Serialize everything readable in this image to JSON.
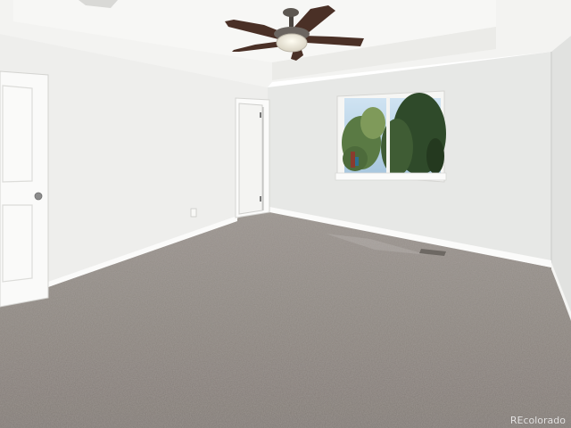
{
  "photo": {
    "subject": "empty-bedroom",
    "watermark": "REcolorado",
    "colors": {
      "ceiling": "#f3f3f1",
      "wall_left": "#eeeeec",
      "wall_back": "#e7e8e6",
      "wall_right": "#e1e2e0",
      "trim": "#fbfbfa",
      "carpet": "#8e8781",
      "window_foliage": "#3f5c34",
      "fan_blade": "#4a3026"
    }
  }
}
